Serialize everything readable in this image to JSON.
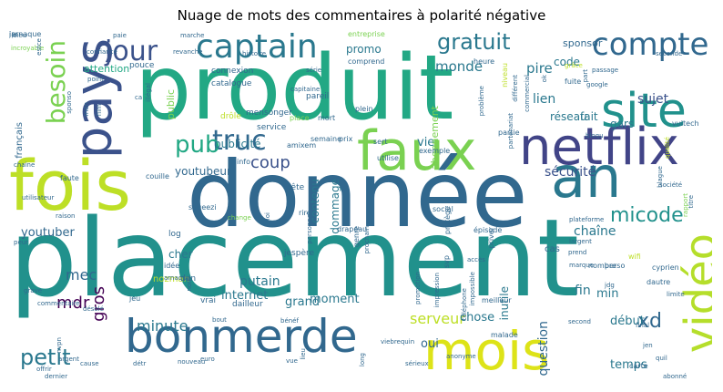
{
  "figure": {
    "title": "Nuage de mots des commentaires à polarité négative"
  },
  "chart_data": {
    "type": "wordcloud",
    "title": "Nuage de mots des commentaires à polarité négative",
    "words": [
      {
        "text": "placement",
        "weight": 100,
        "color": "#21918c"
      },
      {
        "text": "produit",
        "weight": 86,
        "color": "#22a884"
      },
      {
        "text": "donnée",
        "weight": 84,
        "color": "#31688e"
      },
      {
        "text": "fois",
        "weight": 66,
        "color": "#bddf26"
      },
      {
        "text": "mois",
        "weight": 56,
        "color": "#dde318"
      },
      {
        "text": "an",
        "weight": 54,
        "color": "#2a788e"
      },
      {
        "text": "netflix",
        "weight": 52,
        "color": "#414487"
      },
      {
        "text": "faux",
        "weight": 50,
        "color": "#7ad151"
      },
      {
        "text": "pays",
        "weight": 48,
        "color": "#3b528b"
      },
      {
        "text": "bonmerde",
        "weight": 46,
        "color": "#31688e"
      },
      {
        "text": "vidéo",
        "weight": 44,
        "color": "#b5de2b"
      },
      {
        "text": "site",
        "weight": 42,
        "color": "#21918c"
      },
      {
        "text": "captain",
        "weight": 36,
        "color": "#2a788e"
      },
      {
        "text": "compte",
        "weight": 34,
        "color": "#31688e"
      },
      {
        "text": "truc",
        "weight": 30,
        "color": "#31688e"
      },
      {
        "text": "jour",
        "weight": 30,
        "color": "#3b528b"
      },
      {
        "text": "besoin",
        "weight": 28,
        "color": "#7ad151"
      },
      {
        "text": "pub",
        "weight": 26,
        "color": "#22a884"
      },
      {
        "text": "gratuit",
        "weight": 24,
        "color": "#2a788e"
      },
      {
        "text": "petit",
        "weight": 22,
        "color": "#2a788e"
      },
      {
        "text": "micode",
        "weight": 20,
        "color": "#21918c"
      },
      {
        "text": "xd",
        "weight": 20,
        "color": "#31688e"
      },
      {
        "text": "coup",
        "weight": 18,
        "color": "#3b528b"
      },
      {
        "text": "mdr",
        "weight": 18,
        "color": "#440154"
      },
      {
        "text": "gros",
        "weight": 18,
        "color": "#440154"
      },
      {
        "text": "minute",
        "weight": 16,
        "color": "#2a788e"
      },
      {
        "text": "serveur",
        "weight": 16,
        "color": "#bddf26"
      },
      {
        "text": "mec",
        "weight": 16,
        "color": "#31688e"
      },
      {
        "text": "monde",
        "weight": 15,
        "color": "#2a788e"
      },
      {
        "text": "pire",
        "weight": 15,
        "color": "#2a788e"
      },
      {
        "text": "lien",
        "weight": 14,
        "color": "#2a788e"
      },
      {
        "text": "sujet",
        "weight": 14,
        "color": "#3b528b"
      },
      {
        "text": "sécurité",
        "weight": 14,
        "color": "#3b528b"
      },
      {
        "text": "chaîne",
        "weight": 14,
        "color": "#2a788e"
      },
      {
        "text": "youtuber",
        "weight": 13,
        "color": "#31688e"
      },
      {
        "text": "internet",
        "weight": 13,
        "color": "#2a788e"
      },
      {
        "text": "question",
        "weight": 14,
        "color": "#31688e"
      },
      {
        "text": "fin",
        "weight": 14,
        "color": "#2a788e"
      },
      {
        "text": "min",
        "weight": 13,
        "color": "#2a788e"
      },
      {
        "text": "début",
        "weight": 13,
        "color": "#2a788e"
      },
      {
        "text": "temps",
        "weight": 13,
        "color": "#2a788e"
      },
      {
        "text": "putain",
        "weight": 14,
        "color": "#2a788e"
      },
      {
        "text": "moment",
        "weight": 13,
        "color": "#2a788e"
      },
      {
        "text": "oui",
        "weight": 13,
        "color": "#31688e"
      },
      {
        "text": "chose",
        "weight": 13,
        "color": "#2a788e"
      },
      {
        "text": "grand",
        "weight": 13,
        "color": "#2a788e"
      },
      {
        "text": "vie",
        "weight": 13,
        "color": "#2a788e"
      },
      {
        "text": "réseau",
        "weight": 13,
        "color": "#2a788e"
      },
      {
        "text": "fait",
        "weight": 12,
        "color": "#2a788e"
      },
      {
        "text": "gars",
        "weight": 12,
        "color": "#2a788e"
      },
      {
        "text": "promo",
        "weight": 12,
        "color": "#2a788e"
      },
      {
        "text": "code",
        "weight": 12,
        "color": "#2a788e"
      },
      {
        "text": "sponsor",
        "weight": 12,
        "color": "#31688e"
      },
      {
        "text": "public",
        "weight": 11,
        "color": "#7ad151"
      },
      {
        "text": "youtubeur",
        "weight": 11,
        "color": "#31688e"
      },
      {
        "text": "publicité",
        "weight": 12,
        "color": "#2a788e"
      },
      {
        "text": "cher",
        "weight": 12,
        "color": "#2a788e"
      },
      {
        "text": "dommage",
        "weight": 12,
        "color": "#2a788e"
      },
      {
        "text": "contenu",
        "weight": 12,
        "color": "#2a788e"
      },
      {
        "text": "inutile",
        "weight": 12,
        "color": "#2a788e"
      },
      {
        "text": "français",
        "weight": 12,
        "color": "#31688e"
      },
      {
        "text": "abonnement",
        "weight": 10,
        "color": "#7ad151"
      },
      {
        "text": "attention",
        "weight": 11,
        "color": "#22a884"
      },
      {
        "text": "cas",
        "weight": 11,
        "color": "#31688e"
      },
      {
        "text": "pouce",
        "weight": 10,
        "color": "#31688e"
      },
      {
        "text": "connexion",
        "weight": 9,
        "color": "#31688e"
      },
      {
        "text": "catalogue",
        "weight": 9,
        "color": "#31688e"
      },
      {
        "text": "mensonger",
        "weight": 9,
        "color": "#31688e"
      },
      {
        "text": "drôle",
        "weight": 9,
        "color": "#bddf26"
      },
      {
        "text": "service",
        "weight": 9,
        "color": "#31688e"
      },
      {
        "text": "pareil",
        "weight": 9,
        "color": "#31688e"
      },
      {
        "text": "place",
        "weight": 9,
        "color": "#7ad151"
      },
      {
        "text": "log",
        "weight": 8,
        "color": "#31688e"
      },
      {
        "text": "nozman",
        "weight": 9,
        "color": "#bddf26"
      },
      {
        "text": "dun",
        "weight": 10,
        "color": "#31688e"
      },
      {
        "text": "vrai",
        "weight": 9,
        "color": "#31688e"
      },
      {
        "text": "dailleur",
        "weight": 9,
        "color": "#31688e"
      },
      {
        "text": "jespère",
        "weight": 9,
        "color": "#31688e"
      },
      {
        "text": "rire",
        "weight": 9,
        "color": "#31688e"
      },
      {
        "text": "tête",
        "weight": 8,
        "color": "#31688e"
      },
      {
        "text": "squeezi",
        "weight": 9,
        "color": "#31688e"
      },
      {
        "text": "couille",
        "weight": 8,
        "color": "#31688e"
      },
      {
        "text": "info",
        "weight": 8,
        "color": "#31688e"
      },
      {
        "text": "amixem",
        "weight": 8,
        "color": "#31688e"
      },
      {
        "text": "semaine",
        "weight": 8,
        "color": "#31688e"
      },
      {
        "text": "mort",
        "weight": 8,
        "color": "#31688e"
      },
      {
        "text": "plein",
        "weight": 8,
        "color": "#31688e"
      },
      {
        "text": "prix",
        "weight": 8,
        "color": "#31688e"
      },
      {
        "text": "sert",
        "weight": 8,
        "color": "#31688e"
      },
      {
        "text": "exemple",
        "weight": 8,
        "color": "#31688e"
      },
      {
        "text": "utilise",
        "weight": 8,
        "color": "#31688e"
      },
      {
        "text": "entreprise",
        "weight": 8,
        "color": "#7ad151"
      },
      {
        "text": "comprend",
        "weight": 8,
        "color": "#31688e"
      },
      {
        "text": "série",
        "weight": 7,
        "color": "#31688e"
      },
      {
        "text": "société",
        "weight": 7,
        "color": "#31688e"
      },
      {
        "text": "seconde",
        "weight": 7,
        "color": "#31688e"
      },
      {
        "text": "heure",
        "weight": 8,
        "color": "#31688e"
      },
      {
        "text": "niveau",
        "weight": 8,
        "color": "#bddf26"
      },
      {
        "text": "grâce",
        "weight": 7,
        "color": "#bddf26"
      },
      {
        "text": "part",
        "weight": 7,
        "color": "#31688e"
      },
      {
        "text": "fuite",
        "weight": 7,
        "color": "#31688e"
      },
      {
        "text": "google",
        "weight": 8,
        "color": "#31688e"
      },
      {
        "text": "passage",
        "weight": 7,
        "color": "#31688e"
      },
      {
        "text": "vuitech",
        "weight": 7,
        "color": "#31688e"
      },
      {
        "text": "bloqu",
        "weight": 8,
        "color": "#31688e"
      },
      {
        "text": "partie",
        "weight": 7,
        "color": "#31688e"
      },
      {
        "text": "chaine",
        "weight": 8,
        "color": "#31688e"
      },
      {
        "text": "faute",
        "weight": 7,
        "color": "#31688e"
      },
      {
        "text": "utilisateur",
        "weight": 8,
        "color": "#31688e"
      },
      {
        "text": "raison",
        "weight": 7,
        "color": "#31688e"
      },
      {
        "text": "peur",
        "weight": 7,
        "color": "#31688e"
      },
      {
        "text": "idée",
        "weight": 7,
        "color": "#31688e"
      },
      {
        "text": "arnaque",
        "weight": 8,
        "color": "#31688e"
      },
      {
        "text": "change",
        "weight": 7,
        "color": "#7ad151"
      },
      {
        "text": "loi",
        "weight": 7,
        "color": "#31688e"
      },
      {
        "text": "personnel",
        "weight": 7,
        "color": "#31688e"
      },
      {
        "text": "drapeau",
        "weight": 7,
        "color": "#31688e"
      },
      {
        "text": "genre",
        "weight": 8,
        "color": "#31688e"
      },
      {
        "text": "prochain",
        "weight": 8,
        "color": "#31688e"
      },
      {
        "text": "social",
        "weight": 7,
        "color": "#31688e"
      },
      {
        "text": "protège",
        "weight": 8,
        "color": "#31688e"
      },
      {
        "text": "épisode",
        "weight": 8,
        "color": "#31688e"
      },
      {
        "text": "priver",
        "weight": 8,
        "color": "#31688e"
      },
      {
        "text": "plateforme",
        "weight": 8,
        "color": "#31688e"
      },
      {
        "text": "wifi",
        "weight": 7,
        "color": "#bddf26"
      },
      {
        "text": "largent",
        "weight": 8,
        "color": "#31688e"
      },
      {
        "text": "perso",
        "weight": 7,
        "color": "#31688e"
      },
      {
        "text": "marque",
        "weight": 8,
        "color": "#31688e"
      },
      {
        "text": "titre",
        "weight": 7,
        "color": "#31688e"
      },
      {
        "text": "rapport",
        "weight": 7,
        "color": "#7ad151"
      },
      {
        "text": "cyprien",
        "weight": 7,
        "color": "#31688e"
      },
      {
        "text": "dautre",
        "weight": 8,
        "color": "#31688e"
      },
      {
        "text": "nombre",
        "weight": 8,
        "color": "#31688e"
      },
      {
        "text": "prend",
        "weight": 8,
        "color": "#31688e"
      },
      {
        "text": "jdg",
        "weight": 7,
        "color": "#31688e"
      },
      {
        "text": "limite",
        "weight": 7,
        "color": "#31688e"
      },
      {
        "text": "final",
        "weight": 7,
        "color": "#31688e"
      },
      {
        "text": "second",
        "weight": 7,
        "color": "#31688e"
      },
      {
        "text": "jen",
        "weight": 7,
        "color": "#31688e"
      },
      {
        "text": "carte",
        "weight": 7,
        "color": "#31688e"
      },
      {
        "text": "quil",
        "weight": 8,
        "color": "#31688e"
      },
      {
        "text": "abonné",
        "weight": 7,
        "color": "#31688e"
      },
      {
        "text": "malade",
        "weight": 7,
        "color": "#31688e"
      },
      {
        "text": "meilleur",
        "weight": 8,
        "color": "#31688e"
      },
      {
        "text": "accès",
        "weight": 8,
        "color": "#31688e"
      },
      {
        "text": "svp",
        "weight": 7,
        "color": "#31688e"
      },
      {
        "text": "impression",
        "weight": 8,
        "color": "#31688e"
      },
      {
        "text": "promotion",
        "weight": 7,
        "color": "#31688e"
      },
      {
        "text": "téléphone",
        "weight": 7,
        "color": "#31688e"
      },
      {
        "text": "viebrequin",
        "weight": 7,
        "color": "#31688e"
      },
      {
        "text": "anonyme",
        "weight": 7,
        "color": "#31688e"
      },
      {
        "text": "sérieux",
        "weight": 7,
        "color": "#31688e"
      },
      {
        "text": "long",
        "weight": 7,
        "color": "#31688e"
      },
      {
        "text": "lieu",
        "weight": 7,
        "color": "#31688e"
      },
      {
        "text": "vue",
        "weight": 7,
        "color": "#31688e"
      },
      {
        "text": "euro",
        "weight": 7,
        "color": "#31688e"
      },
      {
        "text": "nouveau",
        "weight": 7,
        "color": "#31688e"
      },
      {
        "text": "détr",
        "weight": 7,
        "color": "#31688e"
      },
      {
        "text": "cause",
        "weight": 7,
        "color": "#31688e"
      },
      {
        "text": "dernier",
        "weight": 7,
        "color": "#31688e"
      },
      {
        "text": "argent",
        "weight": 7,
        "color": "#31688e"
      },
      {
        "text": "offrir",
        "weight": 7,
        "color": "#31688e"
      },
      {
        "text": "nvpn",
        "weight": 7,
        "color": "#31688e"
      },
      {
        "text": "jeu",
        "weight": 7,
        "color": "#31688e"
      },
      {
        "text": "désolé",
        "weight": 7,
        "color": "#31688e"
      },
      {
        "text": "grave",
        "weight": 8,
        "color": "#31688e"
      },
      {
        "text": "commentaire",
        "weight": 7,
        "color": "#31688e"
      },
      {
        "text": "bout",
        "weight": 7,
        "color": "#31688e"
      },
      {
        "text": "bénéf",
        "weight": 7,
        "color": "#31688e"
      },
      {
        "text": "nom",
        "weight": 7,
        "color": "#31688e"
      },
      {
        "text": "dieu",
        "weight": 7,
        "color": "#31688e"
      },
      {
        "text": "incroyable",
        "weight": 7,
        "color": "#7ad151"
      },
      {
        "text": "confiance",
        "weight": 7,
        "color": "#31688e"
      },
      {
        "text": "paie",
        "weight": 7,
        "color": "#31688e"
      },
      {
        "text": "marche",
        "weight": 7,
        "color": "#31688e"
      },
      {
        "text": "revanche",
        "weight": 7,
        "color": "#31688e"
      },
      {
        "text": "histoire",
        "weight": 7,
        "color": "#31688e"
      },
      {
        "text": "estce",
        "weight": 7,
        "color": "#31688e"
      },
      {
        "text": "point",
        "weight": 7,
        "color": "#31688e"
      },
      {
        "text": "illégal",
        "weight": 7,
        "color": "#31688e"
      },
      {
        "text": "ca",
        "weight": 7,
        "color": "#31688e"
      },
      {
        "text": "sponso",
        "weight": 7,
        "color": "#31688e"
      },
      {
        "text": "men",
        "weight": 7,
        "color": "#31688e"
      },
      {
        "text": "film",
        "weight": 7,
        "color": "#31688e"
      },
      {
        "text": "capitaine",
        "weight": 7,
        "color": "#31688e"
      },
      {
        "text": "commercial",
        "weight": 7,
        "color": "#31688e"
      },
      {
        "text": "ok",
        "weight": 7,
        "color": "#31688e"
      },
      {
        "text": "partenariat",
        "weight": 7,
        "color": "#31688e"
      },
      {
        "text": "différent",
        "weight": 7,
        "color": "#31688e"
      },
      {
        "text": "problème",
        "weight": 7,
        "color": "#31688e"
      },
      {
        "text": "qualité",
        "weight": 7,
        "color": "#bddf26"
      },
      {
        "text": "blague",
        "weight": 7,
        "color": "#31688e"
      },
      {
        "text": "impossible",
        "weight": 7,
        "color": "#31688e"
      },
      {
        "text": "ip",
        "weight": 7,
        "color": "#31688e"
      },
      {
        "text": "jarnaque",
        "weight": 7,
        "color": "#31688e"
      }
    ]
  }
}
